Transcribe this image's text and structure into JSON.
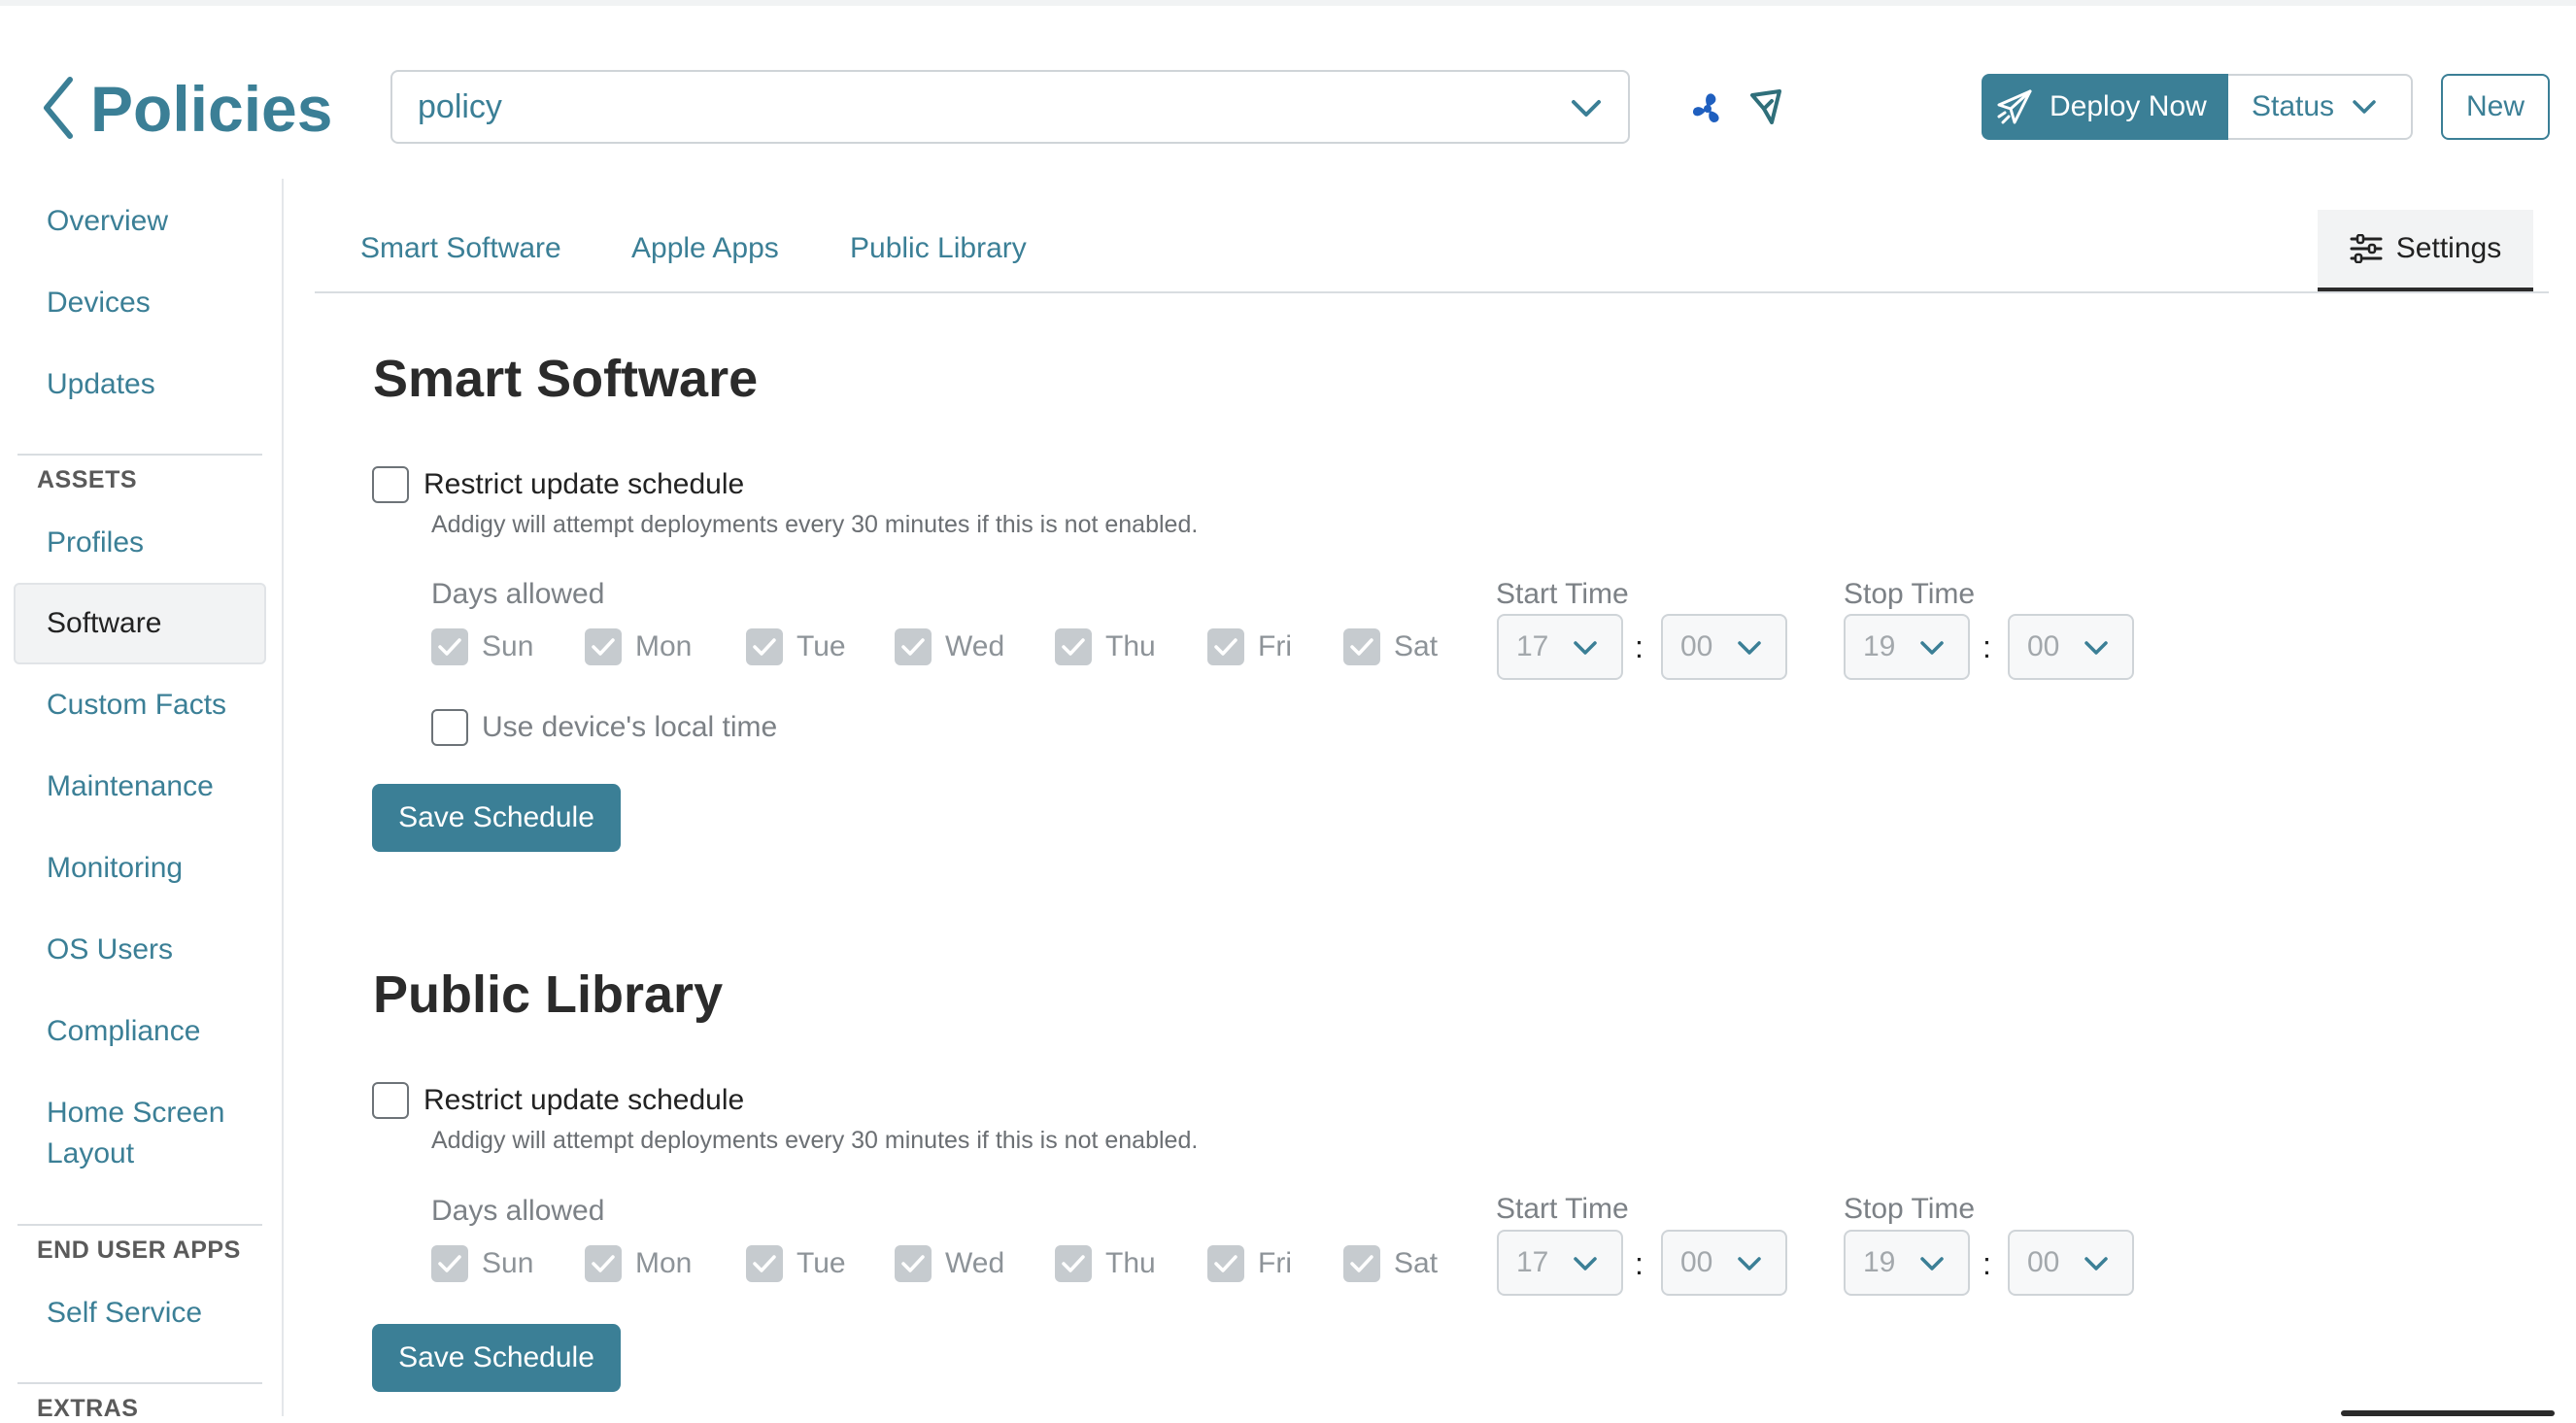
{
  "header": {
    "title": "Policies",
    "policy_select_value": "policy",
    "deploy_label": "Deploy Now",
    "status_label": "Status",
    "new_label": "New"
  },
  "sidebar": {
    "items_top": [
      "Overview",
      "Devices",
      "Updates"
    ],
    "assets_heading": "ASSETS",
    "assets_items": [
      "Profiles",
      "Software",
      "Custom Facts",
      "Maintenance",
      "Monitoring",
      "OS Users",
      "Compliance",
      "Home Screen Layout"
    ],
    "active_item": "Software",
    "end_user_heading": "END USER APPS",
    "end_user_items": [
      "Self Service"
    ],
    "extras_heading": "EXTRAS"
  },
  "tabs": {
    "items": [
      "Smart Software",
      "Apple Apps",
      "Public Library"
    ],
    "settings_label": "Settings"
  },
  "sections": [
    {
      "title": "Smart Software",
      "restrict_label": "Restrict update schedule",
      "restrict_checked": false,
      "hint": "Addigy will attempt deployments every 30 minutes if this is not enabled.",
      "days_label": "Days allowed",
      "days": [
        "Sun",
        "Mon",
        "Tue",
        "Wed",
        "Thu",
        "Fri",
        "Sat"
      ],
      "start_label": "Start Time",
      "start_hour": "17",
      "start_min": "00",
      "stop_label": "Stop Time",
      "stop_hour": "19",
      "stop_min": "00",
      "local_time_label": "Use device's local time",
      "save_label": "Save Schedule"
    },
    {
      "title": "Public Library",
      "restrict_label": "Restrict update schedule",
      "restrict_checked": false,
      "hint": "Addigy will attempt deployments every 30 minutes if this is not enabled.",
      "days_label": "Days allowed",
      "days": [
        "Sun",
        "Mon",
        "Tue",
        "Wed",
        "Thu",
        "Fri",
        "Sat"
      ],
      "start_label": "Start Time",
      "start_hour": "17",
      "start_min": "00",
      "stop_label": "Stop Time",
      "stop_hour": "19",
      "stop_min": "00",
      "save_label": "Save Schedule"
    }
  ],
  "colors": {
    "accent": "#3b7f96",
    "text": "#2b2b2b",
    "muted": "#7c8186",
    "disabled_check": "#c6cbcf"
  },
  "icons": [
    "chevron-left-icon",
    "chevron-down-icon",
    "fan-icon",
    "map-pin-icon",
    "paper-plane-icon",
    "sliders-icon",
    "check-icon"
  ]
}
